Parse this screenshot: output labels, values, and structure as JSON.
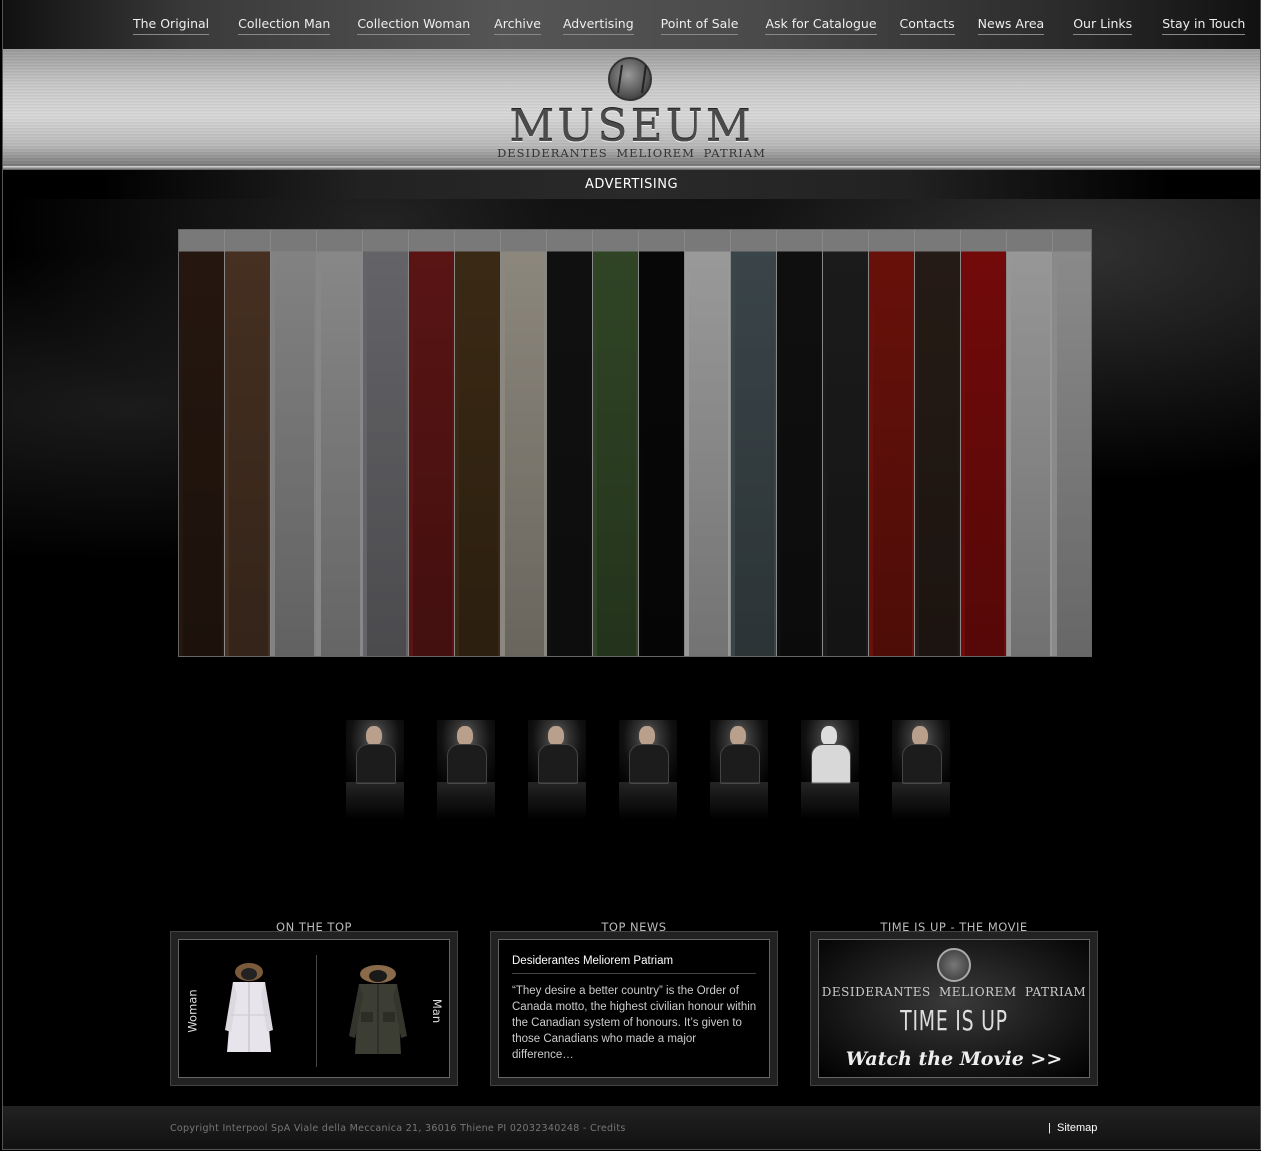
{
  "nav": {
    "items": [
      {
        "label": "The Original"
      },
      {
        "label": "Collection Man"
      },
      {
        "label": "Collection Woman"
      },
      {
        "label": "Archive"
      },
      {
        "label": "Advertising"
      },
      {
        "label": "Point of Sale"
      },
      {
        "label": "Ask for Catalogue"
      },
      {
        "label": "Contacts"
      },
      {
        "label": "News Area"
      },
      {
        "label": "Our Links"
      },
      {
        "label": "Stay in Touch"
      }
    ]
  },
  "header": {
    "logo_text": "MUSEUM",
    "logo_sub": "DESIDERANTES MELIOREM PATRIAM"
  },
  "section": {
    "title": "ADVERTISING"
  },
  "gallery": {
    "strip_colors": [
      "#3a2418",
      "#6b4a34",
      "#c8c8c8",
      "#d0d0d0",
      "#9a9aa0",
      "#8a2020",
      "#5a4020",
      "#d8d0c0",
      "#1a1a1a",
      "#4a6a3a",
      "#0c0c0c",
      "#ececec",
      "#5a6a70",
      "#181818",
      "#2a2a2a",
      "#a01a10",
      "#3a2a22",
      "#b01010",
      "#e8e8e8",
      "#d4d4d4"
    ]
  },
  "thumbnails": {
    "items": [
      {
        "name": "thumb-1"
      },
      {
        "name": "thumb-2"
      },
      {
        "name": "thumb-3"
      },
      {
        "name": "thumb-4"
      },
      {
        "name": "thumb-5"
      },
      {
        "name": "thumb-6"
      },
      {
        "name": "thumb-7"
      }
    ]
  },
  "on_top": {
    "title": "ON THE TOP",
    "woman_label": "Woman",
    "man_label": "Man"
  },
  "top_news": {
    "title": "TOP NEWS",
    "headline": "Desiderantes Meliorem Patriam",
    "body": "“They desire a better country” is the Order of Canada motto, the highest civilian honour within the Canadian system of honours. It’s given to those Canadians who made a major difference…"
  },
  "movie": {
    "title": "TIME IS UP - THE MOVIE",
    "motto": "DESIDERANTES MELIOREM PATRIAM",
    "banner_title": "TIME IS UP",
    "watch_label": "Watch the Movie >>"
  },
  "footer": {
    "copyright": "Copyright Interpool SpA Viale della Meccanica 21, 36016 Thiene PI 02032340248 - Credits",
    "sitemap": "Sitemap"
  },
  "colors": {
    "background": "#000000",
    "header_band": "#c9c9c9",
    "nav_text": "#eeeeee"
  }
}
